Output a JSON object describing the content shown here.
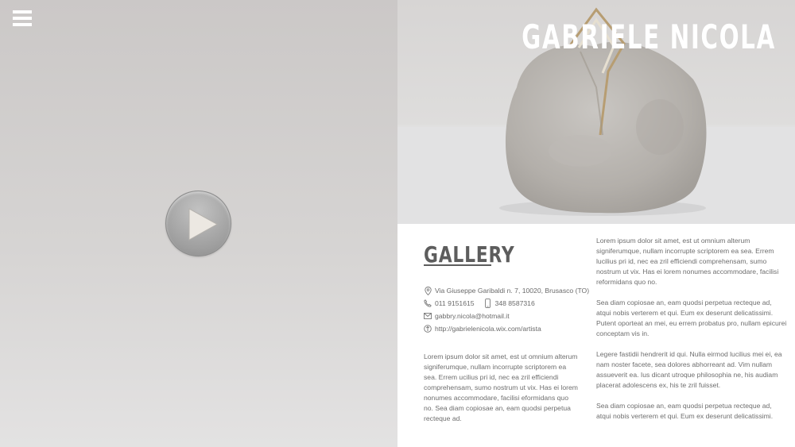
{
  "header": {
    "menu_icon": "hamburger-icon",
    "artist_name": "GABRIELE NICOLA"
  },
  "video": {
    "play_icon": "play-icon"
  },
  "section": {
    "title": "GALLERY"
  },
  "contact": {
    "address": "Via Giuseppe Garibaldi n. 7, 10020, Brusasco (TO)",
    "phone": "011 9151615",
    "mobile": "348 8587316",
    "email": "gabbry.nicola@hotmail.it",
    "website": "http://gabrielenicola.wix.com/artista"
  },
  "body_left": "Lorem ipsum dolor sit amet, est ut omnium alterum signiferumque, nullam incorrupte scriptorem ea sea. Errem  ucilius pri id, nec ea zril efficiendi comprehensam, sumo nostrum ut vix. Has ei lorem nonumes accommodare, facilisi  eformidans quo no. Sea diam copiosae an, eam quodsi perpetua recteque ad.",
  "body_right": [
    "Lorem ipsum dolor sit amet, est ut omnium alterum signiferumque, nullam incorrupte scriptorem ea sea. Errem lucilius pri id, nec ea zril efficiendi comprehensam, sumo nostrum ut vix. Has ei lorem nonumes accommodare, facilisi reformidans quo no.",
    "Sea diam copiosae an, eam quodsi perpetua recteque ad, atqui nobis verterem et qui. Eum ex deserunt delicatissimi. Putent oporteat an mei, eu errem probatus pro, nullam epicurei conceptam vis in.",
    "Legere fastidii hendrerit id qui. Nulla eirmod lucilius mei ei, ea nam noster facete, sea dolores abhorreant ad. Vim nullam assueverit ea. Ius dicant utroque philosophia ne, his audiam placerat adolescens ex, his te zril fuisset.",
    "Sea diam copiosae an, eam quodsi perpetua recteque ad, atqui nobis verterem et qui. Eum ex deserunt delicatissimi."
  ]
}
